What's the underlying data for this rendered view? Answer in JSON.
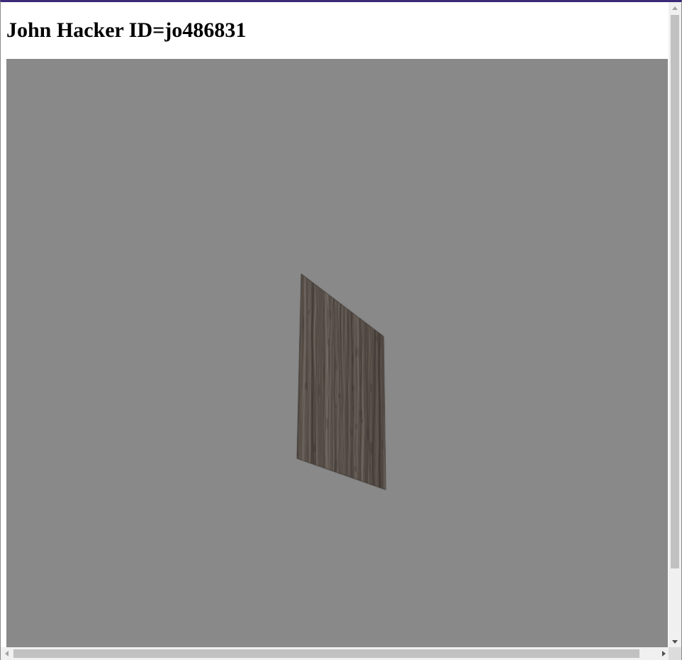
{
  "page": {
    "heading": "John Hacker ID=jo486831"
  },
  "scene": {
    "background_color": "#898989",
    "object": "wood-textured-plane",
    "wood_colors": [
      "#574e48",
      "#6b625b",
      "#48403a",
      "#7a716a",
      "#3c3530"
    ]
  },
  "scrollbars": {
    "vertical": {
      "up_icon": "arrow-up-icon",
      "down_icon": "arrow-down-icon"
    },
    "horizontal": {
      "left_icon": "arrow-left-icon",
      "right_icon": "arrow-right-icon"
    }
  }
}
